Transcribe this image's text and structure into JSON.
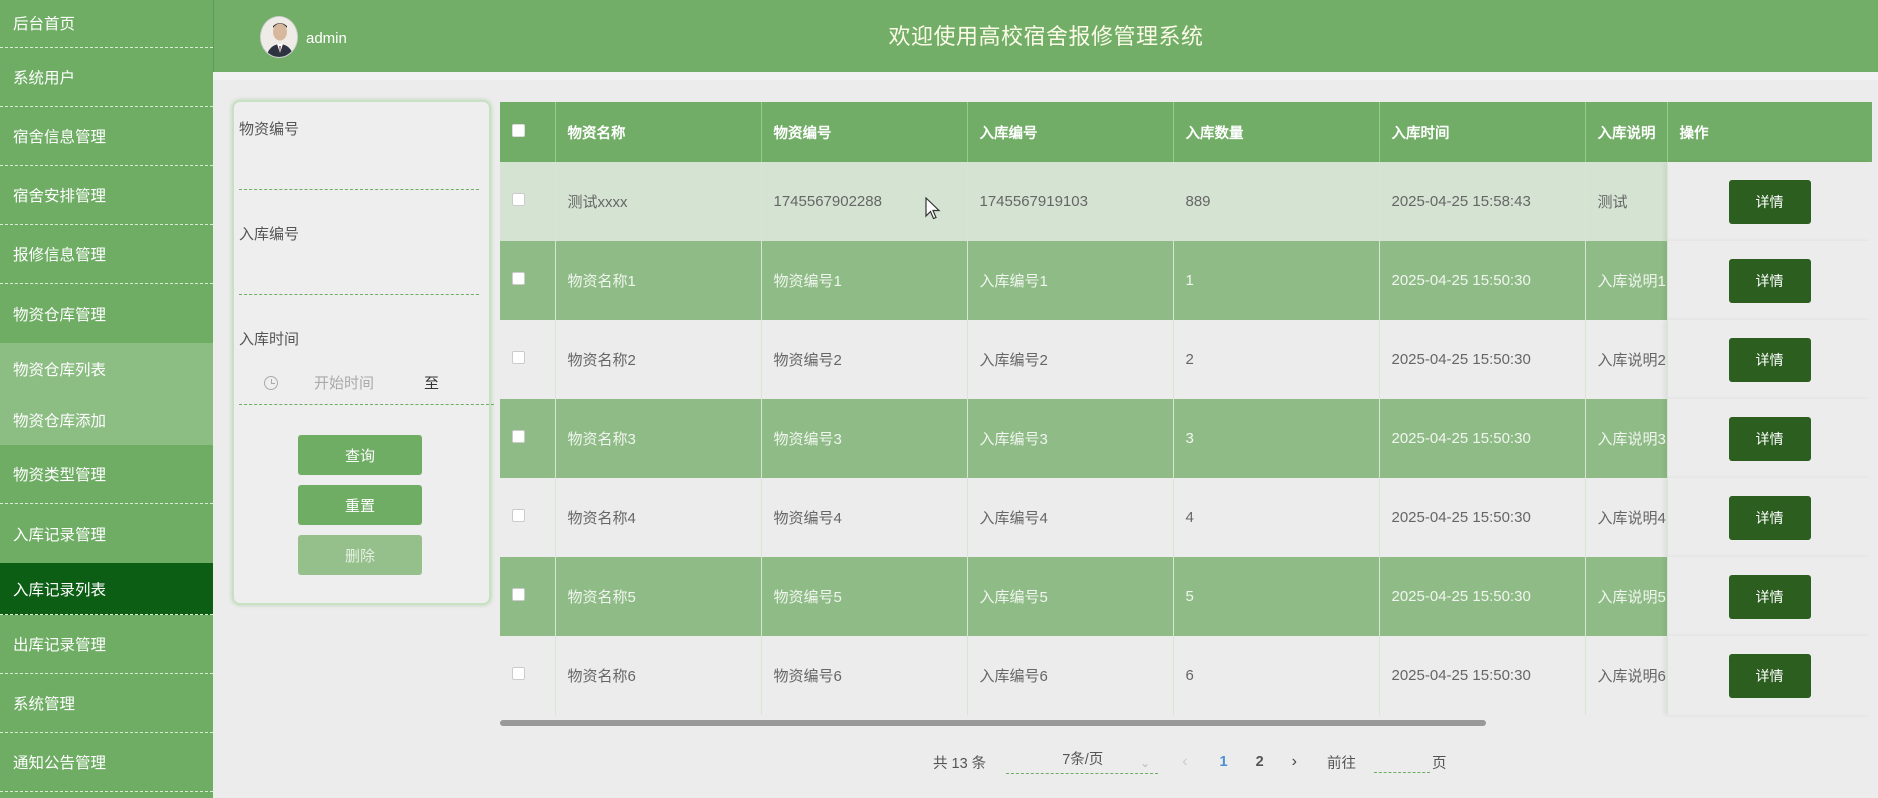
{
  "sidebar": {
    "items": [
      {
        "label": "后台首页"
      },
      {
        "label": "系统用户"
      },
      {
        "label": "宿舍信息管理"
      },
      {
        "label": "宿舍安排管理"
      },
      {
        "label": "报修信息管理"
      },
      {
        "label": "物资仓库管理"
      },
      {
        "label": "物资仓库列表"
      },
      {
        "label": "物资仓库添加"
      },
      {
        "label": "物资类型管理"
      },
      {
        "label": "入库记录管理"
      },
      {
        "label": "入库记录列表"
      },
      {
        "label": "出库记录管理"
      },
      {
        "label": "系统管理"
      },
      {
        "label": "通知公告管理"
      }
    ]
  },
  "header": {
    "username": "admin",
    "title": "欢迎使用高校宿舍报修管理系统"
  },
  "search": {
    "field1_label": "物资编号",
    "field2_label": "入库编号",
    "field3_label": "入库时间",
    "start_placeholder": "开始时间",
    "to_label": "至",
    "query_button": "查询",
    "reset_button": "重置",
    "delete_button": "删除"
  },
  "table": {
    "headers": [
      "物资名称",
      "物资编号",
      "入库编号",
      "入库数量",
      "入库时间",
      "入库说明",
      "操作"
    ],
    "detail_label": "详情",
    "rows": [
      {
        "name": "测试xxxx",
        "code": "1745567902288",
        "in_code": "1745567919103",
        "qty": "889",
        "time": "2025-04-25 15:58:43",
        "note": "测试"
      },
      {
        "name": "物资名称1",
        "code": "物资编号1",
        "in_code": "入库编号1",
        "qty": "1",
        "time": "2025-04-25 15:50:30",
        "note": "入库说明1"
      },
      {
        "name": "物资名称2",
        "code": "物资编号2",
        "in_code": "入库编号2",
        "qty": "2",
        "time": "2025-04-25 15:50:30",
        "note": "入库说明2"
      },
      {
        "name": "物资名称3",
        "code": "物资编号3",
        "in_code": "入库编号3",
        "qty": "3",
        "time": "2025-04-25 15:50:30",
        "note": "入库说明3"
      },
      {
        "name": "物资名称4",
        "code": "物资编号4",
        "in_code": "入库编号4",
        "qty": "4",
        "time": "2025-04-25 15:50:30",
        "note": "入库说明4"
      },
      {
        "name": "物资名称5",
        "code": "物资编号5",
        "in_code": "入库编号5",
        "qty": "5",
        "time": "2025-04-25 15:50:30",
        "note": "入库说明5"
      },
      {
        "name": "物资名称6",
        "code": "物资编号6",
        "in_code": "入库编号6",
        "qty": "6",
        "time": "2025-04-25 15:50:30",
        "note": "入库说明6"
      }
    ]
  },
  "pagination": {
    "total": "共 13 条",
    "page_size": "7条/页",
    "page1": "1",
    "page2": "2",
    "goto_label": "前往",
    "page_suffix": "页"
  },
  "colors": {
    "sidebar": "#6fad65",
    "active_menu": "#0d5e15",
    "header": "#73ae68",
    "detail_button": "#2b5e1f"
  }
}
